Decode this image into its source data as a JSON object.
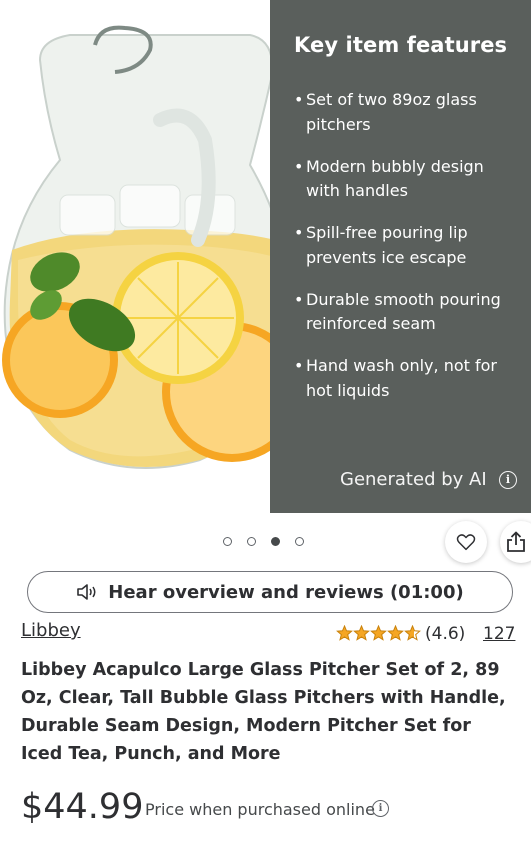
{
  "features": {
    "title": "Key item features",
    "items": [
      "Set of two 89oz glass pitchers",
      "Modern bubbly design with handles",
      "Spill-free pouring lip prevents ice escape",
      "Durable smooth pouring reinforced seam",
      "Hand wash only, not for hot liquids"
    ],
    "ai_label": "Generated by AI",
    "panel_color": "#5a5f5c"
  },
  "carousel": {
    "total": 4,
    "active_index": 3
  },
  "icons": {
    "favorite": "heart-icon",
    "share": "share-icon",
    "audio": "speaker-icon",
    "info": "info-icon"
  },
  "hear": {
    "label": "Hear overview and reviews (01:00)"
  },
  "product": {
    "brand": "Libbey",
    "rating": 4.6,
    "rating_text": "(4.6)",
    "review_count": "127",
    "star_color": "#f5a623",
    "title": "Libbey Acapulco Large Glass Pitcher Set of 2, 89 Oz, Clear, Tall Bubble Glass Pitchers with Handle, Durable Seam Design, Modern Pitcher Set for Iced Tea, Punch, and More",
    "price": "$44.99",
    "price_note": "Price when purchased online"
  }
}
